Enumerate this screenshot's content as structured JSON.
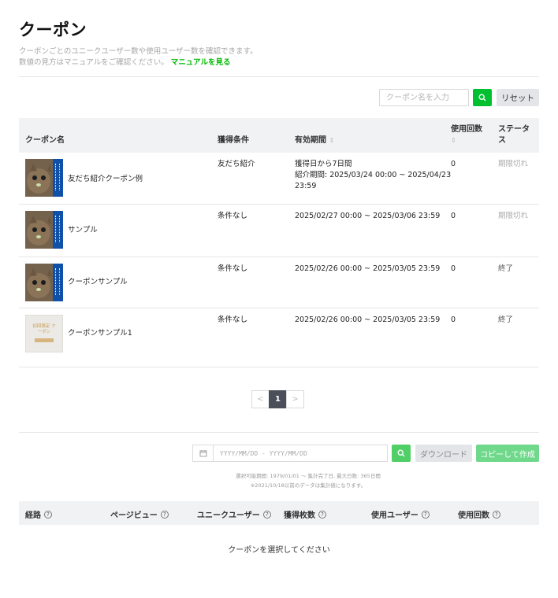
{
  "header": {
    "title": "クーポン",
    "description_line1": "クーポンごとのユニークユーザー数や使用ユーザー数を確認できます。",
    "description_line2": "数値の見方はマニュアルをご確認ください。",
    "manual_link": "マニュアルを見る"
  },
  "search": {
    "placeholder": "クーポン名を入力",
    "value": "",
    "reset_label": "リセット"
  },
  "coupon_table": {
    "columns": {
      "name": "クーポン名",
      "condition": "獲得条件",
      "period": "有効期間",
      "uses_line1": "使用回数",
      "status_line1": "ステータ",
      "status_line2": "ス",
      "sort_glyph": "⇕"
    },
    "rows": [
      {
        "name": "友だち紹介クーポン例",
        "condition": "友だち紹介",
        "period_line1": "獲得日から7日間",
        "period_line2": "紹介期間: 2025/03/24 00:00 ~ 2025/04/23",
        "period_line3": "23:59",
        "uses": "0",
        "status": "期限切れ",
        "thumb": "cat"
      },
      {
        "name": "サンプル",
        "condition": "条件なし",
        "period_line1": "2025/02/27 00:00 ~ 2025/03/06 23:59",
        "period_line2": "",
        "period_line3": "",
        "uses": "0",
        "status": "期限切れ",
        "thumb": "cat"
      },
      {
        "name": "クーポンサンプル",
        "condition": "条件なし",
        "period_line1": "2025/02/26 00:00 ~ 2025/03/05 23:59",
        "period_line2": "",
        "period_line3": "",
        "uses": "0",
        "status": "終了",
        "thumb": "cat"
      },
      {
        "name": "クーポンサンプル1",
        "condition": "条件なし",
        "period_line1": "2025/02/26 00:00 ~ 2025/03/05 23:59",
        "period_line2": "",
        "period_line3": "",
        "uses": "0",
        "status": "終了",
        "thumb": "paper",
        "thumb_text": "初回限定 クーポン"
      }
    ]
  },
  "pagination": {
    "prev": "<",
    "current": "1",
    "next": ">"
  },
  "report": {
    "date_placeholder": "YYYY/MM/DD - YYYY/MM/DD",
    "download_label": "ダウンロード",
    "copy_label": "コピーして作成",
    "note_line1": "選択可能期間: 1979/01/01 ～ 集計完了日, 最大日数: 365日間",
    "note_line2": "※2021/10/18以前のデータは集計値になります。",
    "columns": [
      "経路",
      "ページビュー",
      "ユニークユーザー",
      "獲得枚数",
      "使用ユーザー",
      "使用回数"
    ],
    "help_glyph": "?",
    "empty_message": "クーポンを選択してください"
  },
  "colors": {
    "accent_green": "#00c030",
    "light_green": "#6fd88a",
    "header_gray": "#f1f2f4",
    "expired_gray": "#aaaaaa"
  },
  "icons": {
    "search": "search-icon",
    "calendar": "calendar-icon",
    "help": "help-circle-icon",
    "sort": "sort-icon"
  }
}
